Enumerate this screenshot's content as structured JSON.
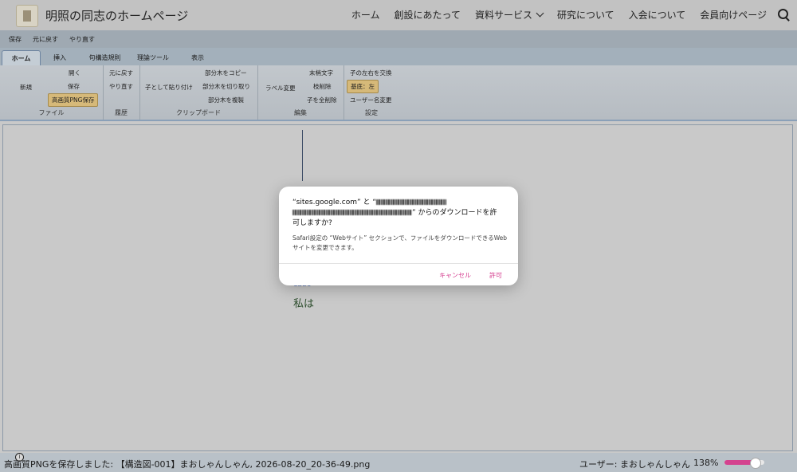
{
  "site": {
    "title": "明照の同志のホームページ",
    "nav": [
      "ホーム",
      "創設にあたって",
      "資料サービス",
      "研究について",
      "入会について",
      "会員向けページ"
    ]
  },
  "quick_access": [
    "保存",
    "元に戻す",
    "やり直す"
  ],
  "tabs": [
    "ホーム",
    "挿入",
    "句構造規則",
    "理論ツール",
    "表示"
  ],
  "ribbon": {
    "file": {
      "label": "ファイル",
      "new": "新規",
      "open": "開く",
      "save": "保存",
      "save_png": "高画質PNG保存"
    },
    "history": {
      "label": "履歴",
      "undo": "元に戻す",
      "redo": "やり直す"
    },
    "clipboard": {
      "label": "クリップボード",
      "paste_child": "子として貼り付け",
      "copy_subtree": "部分木をコピー",
      "cut_subtree": "部分木を切り取り",
      "dup_subtree": "部分木を複製"
    },
    "edit": {
      "label": "編集",
      "change_label": "ラベル変更",
      "final_char": "末梢文字",
      "delete_node": "枝削除",
      "delete_children": "子を全削除"
    },
    "settings": {
      "label": "設定",
      "swap_children": "子の左右を交換",
      "base_left": "基底：左",
      "change_username": "ユーザー名変更"
    }
  },
  "canvas": {
    "node_small": "ebbo",
    "node_text": "私は"
  },
  "dialog": {
    "line1": "“sites.google.com” と “",
    "line2_suffix": "” からのダウンロードを許",
    "line3": "可しますか?",
    "body": "Safari設定の “Webサイト” セクションで、ファイルをダウンロードできるWebサイトを変更できます。",
    "cancel": "キャンセル",
    "allow": "許可"
  },
  "status": {
    "message": "高画質PNGを保存しました: 【構造図-001】まおしゃんしゃん, 2026-08-20_20-36-49.png",
    "user": "ユーザー: まおしゃんしゃん",
    "zoom": "138%",
    "zoom_fraction": 0.69
  },
  "colors": {
    "accent": "#d4428f",
    "ribbon_highlight": "#d6b979"
  }
}
